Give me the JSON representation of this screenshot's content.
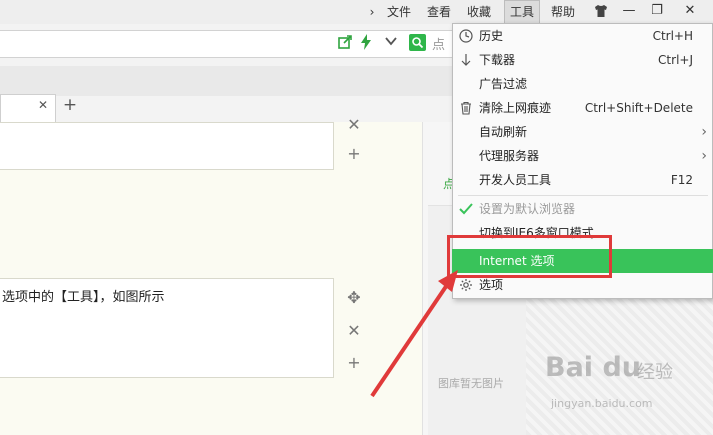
{
  "menubar": {
    "chevron": "›",
    "items": [
      "文件",
      "查看",
      "收藏",
      "工具",
      "帮助"
    ],
    "active_item": "工具"
  },
  "window_controls": {
    "skin": "skin-icon",
    "minimize": "—",
    "maximize": "❐",
    "close": "✕"
  },
  "address_bar": {
    "hint": "点"
  },
  "tabs": {
    "close": "✕",
    "add": "+"
  },
  "editor": {
    "step_text": "选项中的【工具】，如图所示",
    "controls_top": [
      "✕",
      "+"
    ],
    "controls_bottom": [
      "✥",
      "✕",
      "+"
    ]
  },
  "right_panel": {
    "green_fragment": "点",
    "no_image_text": "图库暂无图片"
  },
  "watermark": {
    "logo": "Bai du",
    "brand": "经验",
    "url": "jingyan.baidu.com"
  },
  "tools_menu": {
    "items": [
      {
        "label": "历史",
        "shortcut": "Ctrl+H",
        "icon": "clock-icon"
      },
      {
        "label": "下载器",
        "shortcut": "Ctrl+J",
        "icon": "download-arrow-icon"
      },
      {
        "label": "广告过滤",
        "shortcut": "",
        "icon": ""
      },
      {
        "label": "清除上网痕迹",
        "shortcut": "Ctrl+Shift+Delete",
        "icon": "trash-icon"
      },
      {
        "label": "自动刷新",
        "shortcut": "",
        "submenu": true
      },
      {
        "label": "代理服务器",
        "shortcut": "",
        "submenu": true
      },
      {
        "label": "开发人员工具",
        "shortcut": "F12"
      },
      {
        "label": "设置为默认浏览器",
        "shortcut": "",
        "disabled": true,
        "icon": "checkmark-icon"
      },
      {
        "label": "切换到IE6多窗口模式",
        "shortcut": ""
      },
      {
        "label": "Internet 选项",
        "shortcut": "",
        "highlighted": true
      },
      {
        "label": "选项",
        "shortcut": "",
        "icon": "gear-icon"
      }
    ]
  },
  "colors": {
    "highlight_green": "#39c35a",
    "annotation_red": "#e03a3a",
    "accent_green": "#2fb64a"
  }
}
